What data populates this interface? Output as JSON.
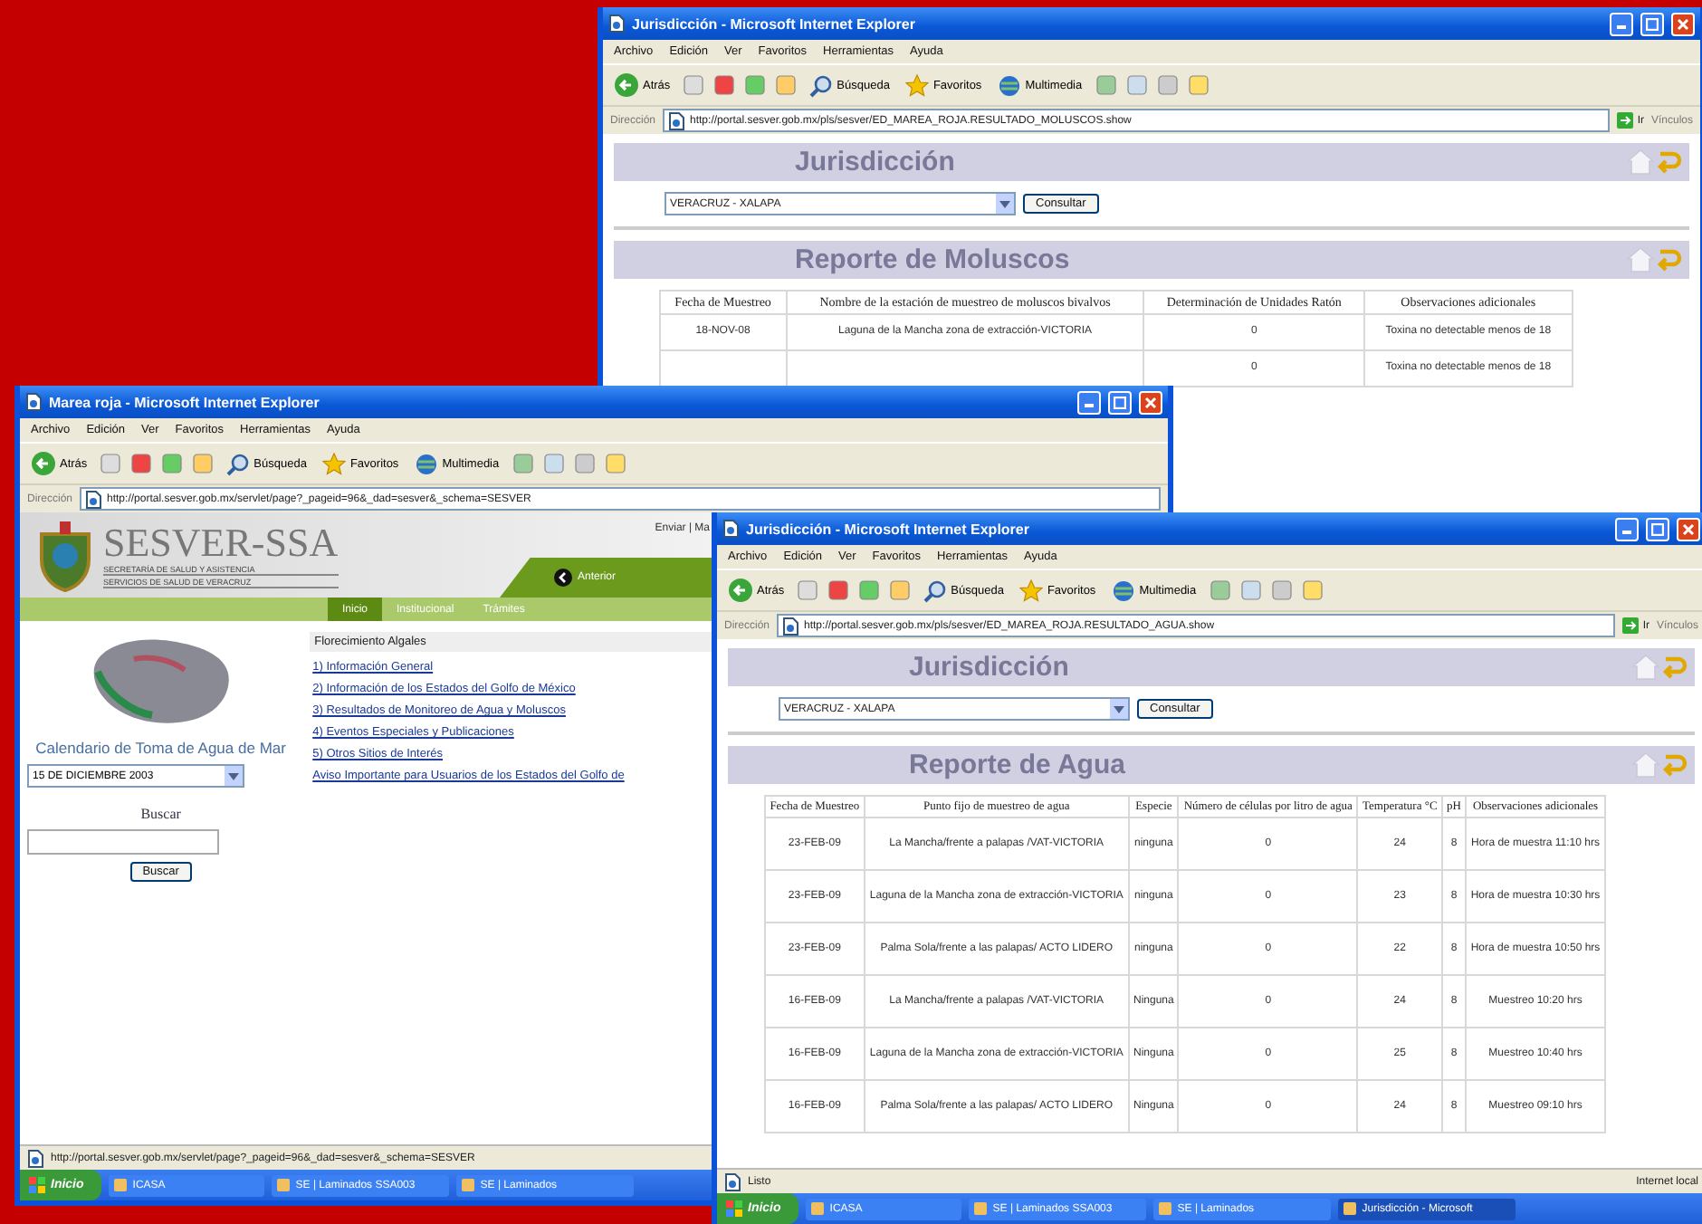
{
  "windows": [
    {
      "kind": "report",
      "title": "Jurisdicción - Microsoft Internet Explorer",
      "menu": [
        "Archivo",
        "Edición",
        "Ver",
        "Favoritos",
        "Herramientas",
        "Ayuda"
      ],
      "toolbar": [
        {
          "kind": "back",
          "label": "Atrás"
        },
        {
          "kind": "search",
          "label": "Búsqueda"
        },
        {
          "kind": "favorites",
          "label": "Favoritos"
        },
        {
          "kind": "media",
          "label": "Multimedia"
        }
      ],
      "address_label": "Dirección",
      "url": "http://portal.sesver.gob.mx/pls/sesver/ED_MAREA_ROJA.RESULTADO_MOLUSCOS.show",
      "go": "Ir",
      "links": "Vínculos",
      "sections": [
        {
          "title": "Jurisdicción",
          "select": "VERACRUZ - XALAPA",
          "button": "Consultar"
        },
        {
          "title": "Reporte de Moluscos",
          "table": {
            "kind": "moluscos",
            "columns": [
              "Fecha de Muestreo",
              "Nombre de la estación de muestreo de moluscos bivalvos",
              "Determinación de Unidades Ratón",
              "Observaciones adicionales"
            ],
            "rows": [
              {
                "date": "18-NOV-08",
                "station": "Laguna de la Mancha zona de extracción-VICTORIA",
                "result": "0",
                "notes": "Toxina no detectable menos de 18"
              },
              {
                "result": "0",
                "notes": "Toxina no detectable menos de 18"
              }
            ]
          }
        }
      ]
    },
    {
      "kind": "portal",
      "title": "Marea roja - Microsoft Internet Explorer",
      "menu": [
        "Archivo",
        "Edición",
        "Ver",
        "Favoritos",
        "Herramientas",
        "Ayuda"
      ],
      "toolbar": [
        {
          "kind": "back",
          "label": "Atrás"
        },
        {
          "kind": "search",
          "label": "Búsqueda"
        },
        {
          "kind": "favorites",
          "label": "Favoritos"
        },
        {
          "kind": "media",
          "label": "Multimedia"
        }
      ],
      "address_label": "Dirección",
      "url": "http://portal.sesver.gob.mx/servlet/page?_pageid=96&_dad=sesver&_schema=SESVER",
      "portal": {
        "logo": "SESVER-SSA",
        "subtitle_1": "SECRETARÍA DE SALUD Y ASISTENCIA",
        "subtitle_2": "SERVICIOS DE SALUD DE VERACRUZ",
        "top_links": "Enviar | Ma",
        "nav_button": "Anterior",
        "tabs": [
          {
            "label": "Inicio",
            "selected": true
          },
          {
            "label": "Institucional",
            "selected": false
          },
          {
            "label": "Trámites",
            "selected": false
          }
        ],
        "caption": "Calendario de Toma de Agua de Mar",
        "date_select": "15 DE DICIEMBRE 2003",
        "search_label": "Buscar",
        "search_button": "Buscar",
        "heading": "Florecimiento Algales",
        "links": [
          "1) Información General",
          "2) Información de los Estados del Golfo de México",
          "3) Resultados de Monitoreo de Agua y Moluscos",
          "4) Eventos Especiales y Publicaciones",
          "5) Otros Sitios de Interés",
          "Aviso Importante para Usuarios de los Estados del Golfo de"
        ]
      },
      "status": "http://portal.sesver.gob.mx/servlet/page?_pageid=96&_dad=sesver&_schema=SESVER",
      "taskbar": {
        "start": "Inicio",
        "items": [
          "ICASA",
          "SE | Laminados SSA003",
          "SE | Laminados"
        ]
      }
    },
    {
      "kind": "report",
      "title": "Jurisdicción - Microsoft Internet Explorer",
      "menu": [
        "Archivo",
        "Edición",
        "Ver",
        "Favoritos",
        "Herramientas",
        "Ayuda"
      ],
      "toolbar": [
        {
          "kind": "back",
          "label": "Atrás"
        },
        {
          "kind": "search",
          "label": "Búsqueda"
        },
        {
          "kind": "favorites",
          "label": "Favoritos"
        },
        {
          "kind": "media",
          "label": "Multimedia"
        }
      ],
      "address_label": "Dirección",
      "url": "http://portal.sesver.gob.mx/pls/sesver/ED_MAREA_ROJA.RESULTADO_AGUA.show",
      "go": "Ir",
      "links": "Vínculos",
      "sections": [
        {
          "title": "Jurisdicción",
          "select": "VERACRUZ - XALAPA",
          "button": "Consultar"
        },
        {
          "title": "Reporte de Agua",
          "table": {
            "kind": "agua",
            "columns": [
              "Fecha de Muestreo",
              "Punto fijo de muestreo de agua",
              "Especie",
              "Número de células por litro de agua",
              "Temperatura °C",
              "pH",
              "Observaciones adicionales"
            ],
            "rows": [
              {
                "date": "23-FEB-09",
                "point": "La Mancha/frente a palapas /VAT-VICTORIA",
                "species": "ninguna",
                "cells": "0",
                "temp": "24",
                "ph": "8",
                "notes": "Hora de muestra 11:10 hrs"
              },
              {
                "date": "23-FEB-09",
                "point": "Laguna de la Mancha zona de extracción-VICTORIA",
                "species": "ninguna",
                "cells": "0",
                "temp": "23",
                "ph": "8",
                "notes": "Hora de muestra 10:30 hrs"
              },
              {
                "date": "23-FEB-09",
                "point": "Palma Sola/frente a las palapas/ ACTO LIDERO",
                "species": "ninguna",
                "cells": "0",
                "temp": "22",
                "ph": "8",
                "notes": "Hora de muestra 10:50 hrs"
              },
              {
                "date": "16-FEB-09",
                "point": "La Mancha/frente a palapas /VAT-VICTORIA",
                "species": "Ninguna",
                "cells": "0",
                "temp": "24",
                "ph": "8",
                "notes": "Muestreo 10:20 hrs"
              },
              {
                "date": "16-FEB-09",
                "point": "Laguna de la Mancha zona de extracción-VICTORIA",
                "species": "Ninguna",
                "cells": "0",
                "temp": "25",
                "ph": "8",
                "notes": "Muestreo 10:40 hrs"
              },
              {
                "date": "16-FEB-09",
                "point": "Palma Sola/frente a las palapas/ ACTO LIDERO",
                "species": "Ninguna",
                "cells": "0",
                "temp": "24",
                "ph": "8",
                "notes": "Muestreo 09:10 hrs"
              }
            ]
          }
        }
      ],
      "status": "Listo",
      "zone": "Internet local",
      "taskbar": {
        "start": "Inicio",
        "items": [
          "ICASA",
          "SE | Laminados SSA003",
          "SE | Laminados",
          "Jurisdicción - Microsoft"
        ]
      }
    }
  ]
}
